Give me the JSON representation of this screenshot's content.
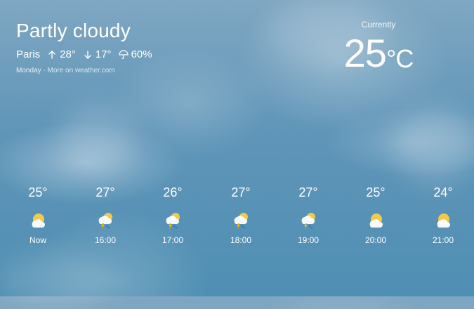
{
  "weather": {
    "condition": "Partly cloudy",
    "city": "Paris",
    "high": "28°",
    "low": "17°",
    "precip": "60%",
    "day": "Monday",
    "separator": "·",
    "more_link": "More on weather.com"
  },
  "current": {
    "label": "Currently",
    "temp": "25",
    "unit": "°C"
  },
  "forecast": [
    {
      "temp": "25°",
      "time": "Now",
      "icon": "partly-cloudy-icon"
    },
    {
      "temp": "27°",
      "time": "16:00",
      "icon": "thunderstorm-icon"
    },
    {
      "temp": "26°",
      "time": "17:00",
      "icon": "thunderstorm-icon"
    },
    {
      "temp": "27°",
      "time": "18:00",
      "icon": "thunderstorm-icon"
    },
    {
      "temp": "27°",
      "time": "19:00",
      "icon": "thunderstorm-icon"
    },
    {
      "temp": "25°",
      "time": "20:00",
      "icon": "partly-cloudy-icon"
    },
    {
      "temp": "24°",
      "time": "21:00",
      "icon": "partly-cloudy-icon"
    }
  ],
  "colors": {
    "sun": "#f2c94c",
    "cloud": "#ffffff",
    "bolt": "#ffb300",
    "rain": "#1f6fbf"
  }
}
